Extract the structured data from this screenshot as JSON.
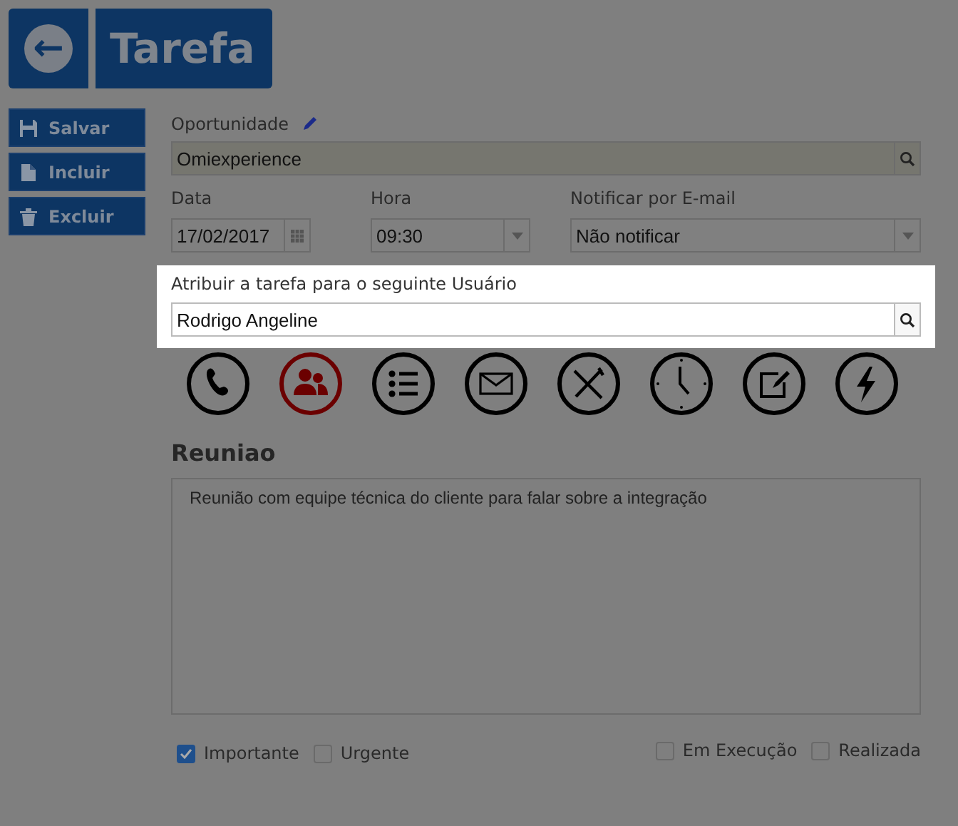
{
  "header": {
    "back_icon": "←",
    "title": "Tarefa"
  },
  "actions": [
    {
      "kind": "save",
      "label": "Salvar"
    },
    {
      "kind": "new",
      "label": "Incluir"
    },
    {
      "kind": "delete",
      "label": "Excluir"
    }
  ],
  "opportunity": {
    "label": "Oportunidade",
    "value": "Omiexperience"
  },
  "date": {
    "label": "Data",
    "value": "17/02/2017"
  },
  "time": {
    "label": "Hora",
    "value": "09:30"
  },
  "notify": {
    "label": "Notificar por E-mail",
    "value": "Não notificar"
  },
  "assignee": {
    "label": "Atribuir a tarefa para o seguinte Usuário",
    "value": "Rodrigo Angeline"
  },
  "task_types": [
    {
      "kind": "phone",
      "selected": false
    },
    {
      "kind": "meeting",
      "selected": true
    },
    {
      "kind": "list",
      "selected": false
    },
    {
      "kind": "mail",
      "selected": false
    },
    {
      "kind": "meal",
      "selected": false
    },
    {
      "kind": "clock",
      "selected": false
    },
    {
      "kind": "note",
      "selected": false
    },
    {
      "kind": "flash",
      "selected": false
    }
  ],
  "section_title": "Reuniao",
  "description": "Reunião com equipe técnica do cliente para falar sobre a integração",
  "flags_left": [
    {
      "label": "Importante",
      "checked": true
    },
    {
      "label": "Urgente",
      "checked": false
    }
  ],
  "flags_right": [
    {
      "label": "Em Execução",
      "checked": false
    },
    {
      "label": "Realizada",
      "checked": false
    }
  ]
}
